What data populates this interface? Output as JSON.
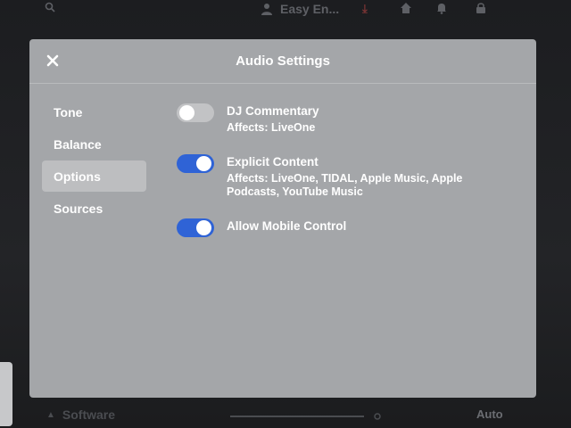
{
  "background": {
    "profile_name": "Easy En...",
    "bottom_left_label": "Software",
    "bottom_right_label": "Auto"
  },
  "modal": {
    "title": "Audio Settings",
    "close_icon": "close-icon"
  },
  "sidebar": {
    "items": [
      {
        "label": "Tone",
        "active": false
      },
      {
        "label": "Balance",
        "active": false
      },
      {
        "label": "Options",
        "active": true
      },
      {
        "label": "Sources",
        "active": false
      }
    ]
  },
  "settings": [
    {
      "title": "DJ Commentary",
      "subtitle": "Affects: LiveOne",
      "enabled": false
    },
    {
      "title": "Explicit Content",
      "subtitle": "Affects: LiveOne, TIDAL, Apple Music, Apple Podcasts, YouTube Music",
      "enabled": true
    },
    {
      "title": "Allow Mobile Control",
      "subtitle": "",
      "enabled": true
    }
  ],
  "colors": {
    "toggle_on": "#2f63d6",
    "toggle_off": "#c2c3c5",
    "modal_bg": "#a4a6a9"
  }
}
